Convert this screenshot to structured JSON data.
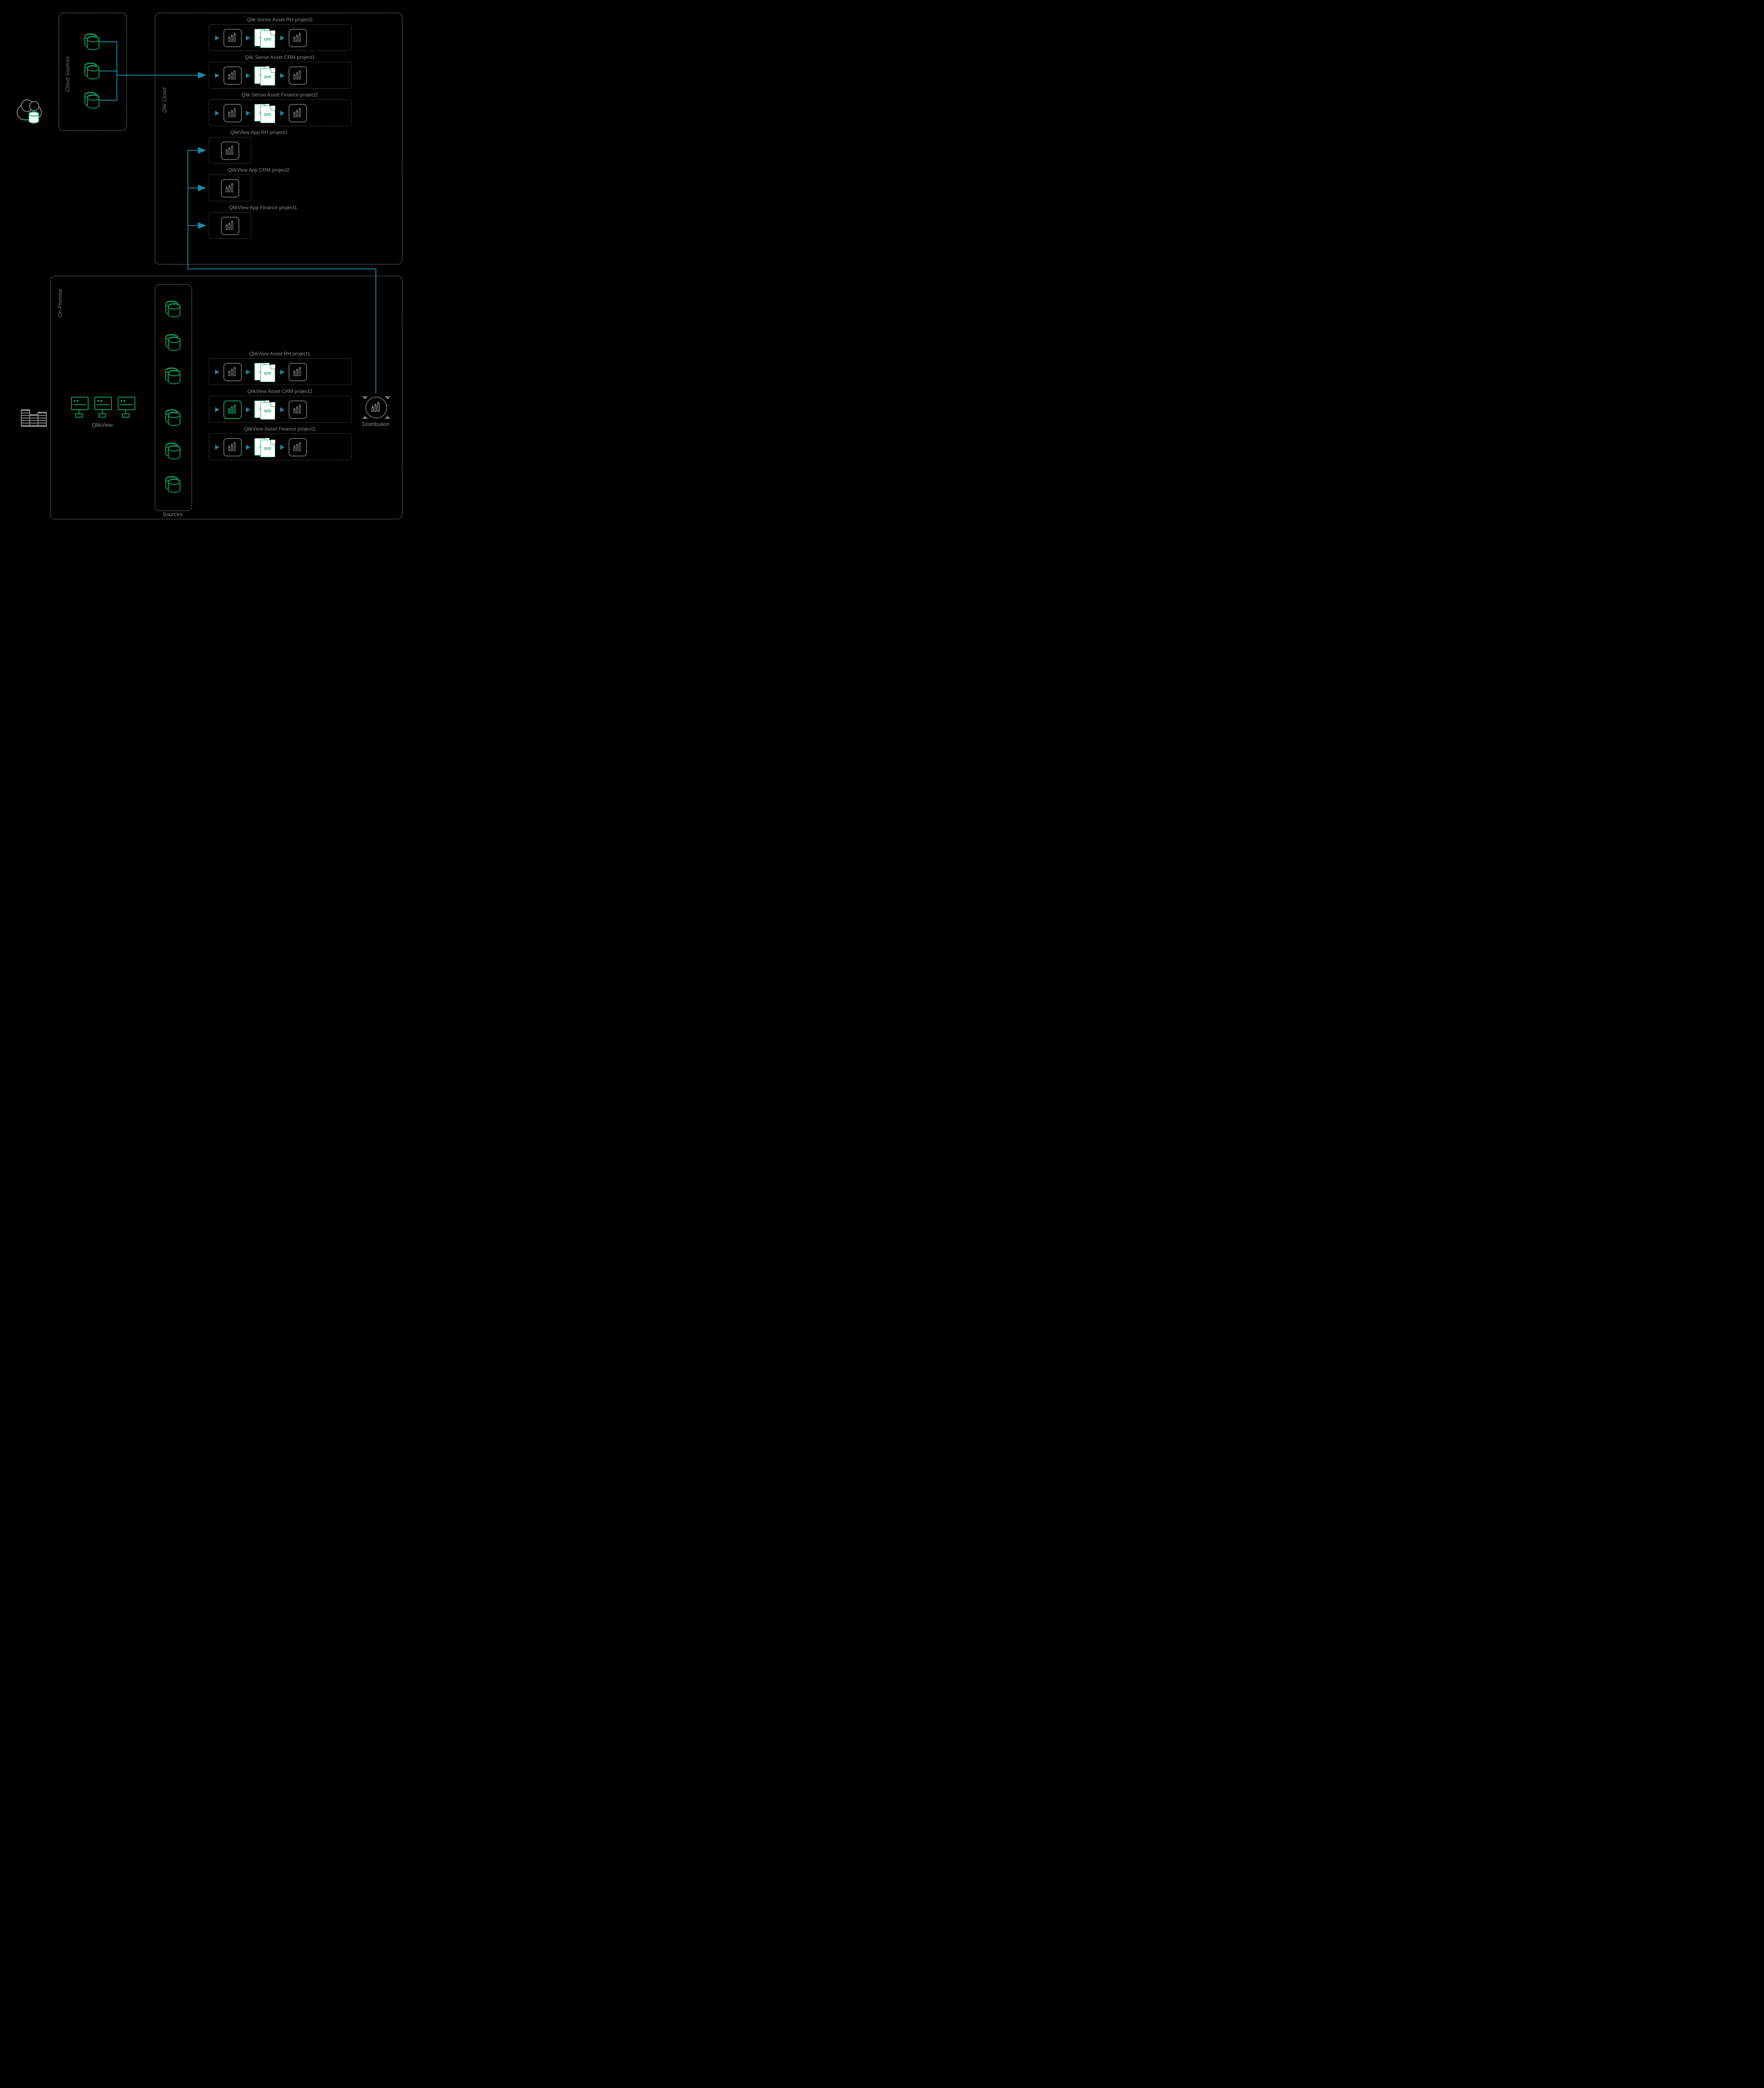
{
  "zones": {
    "cloud_sources": "Cloud Sources",
    "qlik_cloud": "Qlik Cloud",
    "on_premise": "On-Premise",
    "sources": "Sources",
    "qlikview": "QlikView",
    "distribution": "Distribution"
  },
  "assets": {
    "qs_rh2": "Qlik Sense Asset RH project2",
    "qs_crm1": "Qlik Sense Asset CRM project1",
    "qs_fin2": "Qlik Sense Asset Finance project2",
    "qv_app_rh1": "QlikView App RH project1",
    "qv_app_crm2": "QlikView App CRM project2",
    "qv_app_fin1": "QlikView App Finance project1",
    "qv_rh1": "QlikView Asset RH project1",
    "qv_crm2": "QlikView Asset CRM project2",
    "qv_fin1": "QlikView Asset Finance project1"
  },
  "file_labels": {
    "qvd": "QVD",
    "qv": "QV"
  }
}
